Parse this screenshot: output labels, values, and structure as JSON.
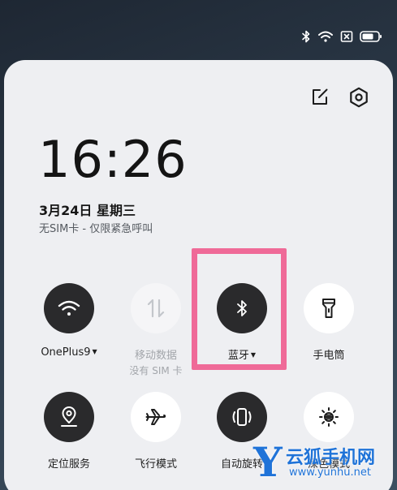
{
  "status_bar": {
    "icons": [
      "bluetooth-icon",
      "wifi-icon",
      "no-sim-icon",
      "battery-icon"
    ]
  },
  "panel": {
    "icons": [
      "edit-icon",
      "settings-icon"
    ]
  },
  "clock": {
    "time": "16:26",
    "date": "3月24日  星期三",
    "sim_status": "无SIM卡 - 仅限紧急呼叫"
  },
  "tiles": [
    {
      "label": "OnePlus9",
      "icon": "wifi-icon",
      "state": "on",
      "has_dropdown": true
    },
    {
      "label": "移动数据",
      "sublabel": "没有 SIM 卡",
      "icon": "mobile-data-icon",
      "state": "disabled"
    },
    {
      "label": "蓝牙",
      "icon": "bluetooth-icon",
      "state": "on",
      "has_dropdown": true
    },
    {
      "label": "手电筒",
      "icon": "flashlight-icon",
      "state": "off"
    },
    {
      "label": "定位服务",
      "icon": "location-icon",
      "state": "on"
    },
    {
      "label": "飞行模式",
      "icon": "airplane-icon",
      "state": "off"
    },
    {
      "label": "自动旋转",
      "icon": "auto-rotate-icon",
      "state": "on"
    },
    {
      "label": "深色模式",
      "icon": "brightness-icon",
      "state": "off"
    }
  ],
  "dropdown_caret": "▼",
  "highlight_color": "#ef6a98",
  "watermark": {
    "logo_letter": "Y",
    "name": "云狐手机网",
    "url": "www.yunhu.net",
    "color": "#1f73d8"
  }
}
